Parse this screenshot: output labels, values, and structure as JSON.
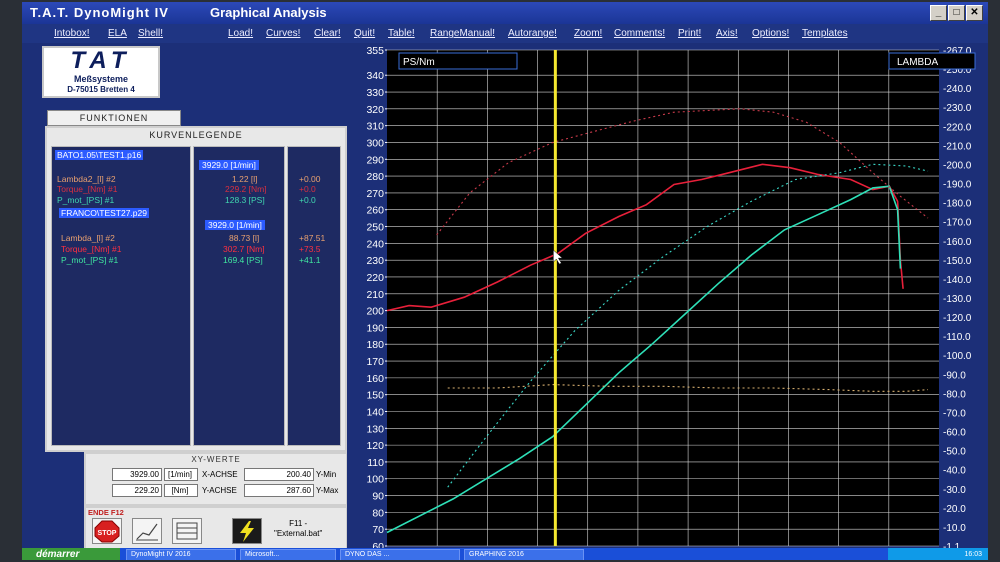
{
  "window": {
    "app_title": "T.A.T. DynoMight IV",
    "title": "Graphical Analysis"
  },
  "menus": [
    "Intobox!",
    "ELA",
    "Shell!",
    "Load!",
    "Curves!",
    "Clear!",
    "Quit!",
    "Table!",
    "RangeManual!",
    "Autorange!",
    "Zoom!",
    "Comments!",
    "Print!",
    "Axis!",
    "Options!",
    "Templates"
  ],
  "logo": {
    "main": "TAT",
    "line1": "Meßsysteme",
    "line2": "D-75015 Bretten 4"
  },
  "funktionen_label": "FUNKTIONEN",
  "legend": {
    "title": "KURVENLEGENDE",
    "files": [
      {
        "name": "BATO1.05\\TEST1.p16",
        "rpm": "3929.0 [1/min]",
        "entries": [
          {
            "name": "Lambda2_[l] #2",
            "value": "1.22 [l]",
            "delta": "+0.00",
            "color": "#e8a070"
          },
          {
            "name": "Torque_[Nm] #1",
            "value": "229.2 [Nm]",
            "delta": "+0.0",
            "color": "#d83040"
          },
          {
            "name": "P_mot_[PS] #1",
            "value": "128.3 [PS]",
            "delta": "+0.0",
            "color": "#40d8b0"
          }
        ]
      },
      {
        "name": "FRANCO\\TEST27.p29",
        "rpm": "3929.0 [1/min]",
        "entries": [
          {
            "name": "Lambda_[l] #2",
            "value": "88.73 [l]",
            "delta": "+87.51",
            "color": "#e8a070"
          },
          {
            "name": "Torque_[Nm] #1",
            "value": "302.7 [Nm]",
            "delta": "+73.5",
            "color": "#ff3040"
          },
          {
            "name": "P_mot_[PS] #1",
            "value": "169.4 [PS]",
            "delta": "+41.1",
            "color": "#40e8a0"
          }
        ]
      }
    ]
  },
  "xy": {
    "title": "XY-WERTE",
    "row1": {
      "value": "3929.00",
      "unit": "[1/min]",
      "axis": "X-ACHSE",
      "limit": "200.40",
      "limit_label": "Y-Min"
    },
    "row2": {
      "value": "229.20",
      "unit": "[Nm]",
      "axis": "Y-ACHSE",
      "limit": "287.60",
      "limit_label": "Y-Max"
    }
  },
  "tools": {
    "ende_label": "ENDE F12",
    "stop_label": "STOP",
    "f11_line1": "F11 -",
    "f11_line2": "\"External.bat\""
  },
  "chart_data": {
    "type": "line",
    "left_axis_label": "PS/Nm",
    "right_axis_label": "LAMBDA",
    "left_ylim": [
      60,
      355
    ],
    "left_ticks": [
      60,
      70,
      80,
      90,
      100,
      110,
      120,
      130,
      140,
      150,
      160,
      170,
      180,
      190,
      200,
      210,
      220,
      230,
      240,
      250,
      260,
      270,
      280,
      290,
      300,
      310,
      320,
      330,
      340,
      355
    ],
    "right_ticks": [
      "1.1",
      "10.0",
      "20.0",
      "30.0",
      "40.0",
      "50.0",
      "60.0",
      "70.0",
      "80.0",
      "90.0",
      "100.0",
      "110.0",
      "120.0",
      "130.0",
      "140.0",
      "150.0",
      "160.0",
      "170.0",
      "180.0",
      "190.0",
      "200.0",
      "210.0",
      "220.0",
      "230.0",
      "240.0",
      "250.0",
      "267.0"
    ],
    "grid": true,
    "cursor_fraction": 0.305,
    "series": [
      {
        "style": "solid",
        "color": "#e8203a",
        "x": [
          0,
          0.04,
          0.08,
          0.14,
          0.2,
          0.26,
          0.31,
          0.36,
          0.42,
          0.47,
          0.52,
          0.57,
          0.62,
          0.68,
          0.73,
          0.78,
          0.84,
          0.88,
          0.91,
          0.925,
          0.93,
          0.935
        ],
        "y": [
          200,
          203,
          202,
          208,
          217,
          227,
          234,
          246,
          256,
          263,
          275,
          278,
          282,
          287,
          285,
          281,
          278,
          272,
          274,
          265,
          230,
          213
        ]
      },
      {
        "style": "solid",
        "color": "#2ee0b8",
        "x": [
          0,
          0.06,
          0.12,
          0.18,
          0.24,
          0.3,
          0.36,
          0.42,
          0.48,
          0.54,
          0.6,
          0.66,
          0.72,
          0.78,
          0.84,
          0.88,
          0.91,
          0.925,
          0.93
        ],
        "y": [
          68,
          78,
          88,
          100,
          112,
          125,
          144,
          163,
          180,
          198,
          216,
          233,
          248,
          257,
          266,
          273,
          274,
          260,
          225
        ]
      },
      {
        "style": "dashed",
        "color": "#c83a4a",
        "x": [
          0.09,
          0.15,
          0.22,
          0.3,
          0.38,
          0.45,
          0.52,
          0.58,
          0.64,
          0.7,
          0.76,
          0.82,
          0.88,
          0.93,
          0.98
        ],
        "y": [
          245,
          270,
          288,
          300,
          307,
          313,
          318,
          319,
          320,
          318,
          312,
          300,
          282,
          268,
          255
        ]
      },
      {
        "style": "dashed",
        "color": "#3ad8c8",
        "x": [
          0.11,
          0.18,
          0.26,
          0.34,
          0.42,
          0.5,
          0.58,
          0.66,
          0.74,
          0.82,
          0.88,
          0.94,
          0.98
        ],
        "y": [
          95,
          125,
          158,
          188,
          212,
          232,
          250,
          265,
          278,
          282,
          287,
          286,
          283
        ]
      },
      {
        "style": "dashed",
        "color": "#d8b070",
        "x": [
          0.11,
          0.2,
          0.3,
          0.4,
          0.5,
          0.6,
          0.7,
          0.8,
          0.88,
          0.94,
          0.98
        ],
        "y": [
          154,
          154,
          156,
          155,
          155,
          154,
          154,
          153,
          152,
          152,
          153
        ]
      }
    ]
  },
  "taskbar": {
    "start": "démarrer",
    "tasks": [
      "DynoMight IV 2016",
      "Microsoft...",
      "DYNO DAS ...",
      "GRAPHING 2016"
    ],
    "clock": "16:03"
  }
}
